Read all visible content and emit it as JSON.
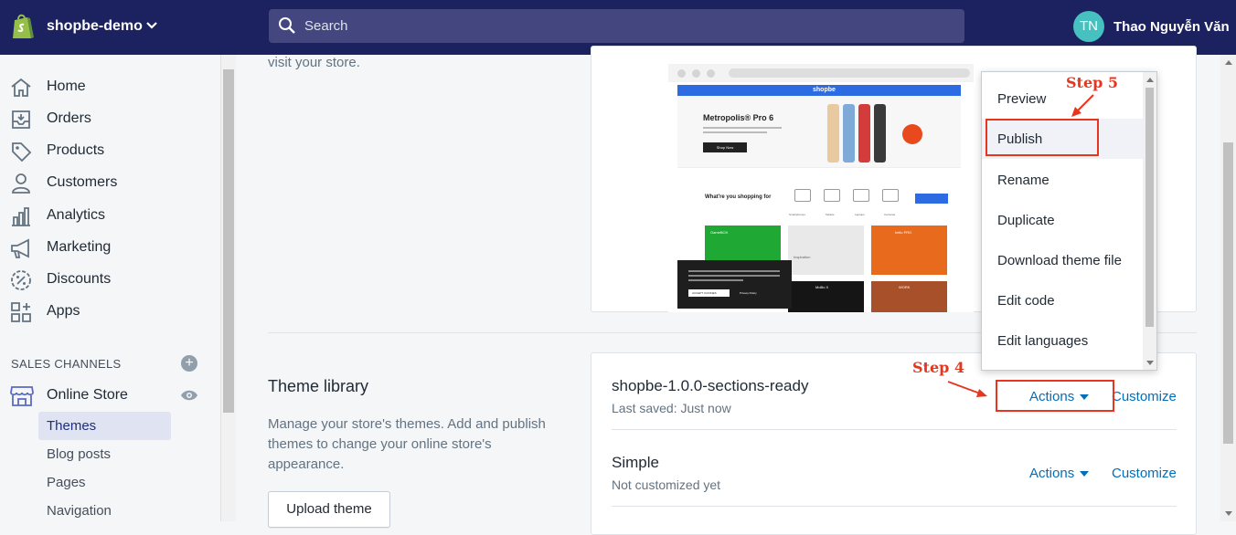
{
  "topbar": {
    "store_name": "shopbe-demo",
    "search_placeholder": "Search",
    "avatar_initials": "TN",
    "user_name": "Thao Nguyễn Văn",
    "bg_color": "#1c2260"
  },
  "sidebar": {
    "items": [
      {
        "label": "Home",
        "icon": "home-icon"
      },
      {
        "label": "Orders",
        "icon": "orders-icon"
      },
      {
        "label": "Products",
        "icon": "tag-icon"
      },
      {
        "label": "Customers",
        "icon": "person-icon"
      },
      {
        "label": "Analytics",
        "icon": "bar-chart-icon"
      },
      {
        "label": "Marketing",
        "icon": "megaphone-icon"
      },
      {
        "label": "Discounts",
        "icon": "discount-icon"
      },
      {
        "label": "Apps",
        "icon": "apps-icon"
      }
    ],
    "section_title": "SALES CHANNELS",
    "channel": "Online Store",
    "sub_items": [
      "Themes",
      "Blog posts",
      "Pages",
      "Navigation"
    ],
    "active_sub_item": "Themes"
  },
  "main": {
    "visit_text": "visit your store.",
    "theme_library": {
      "title": "Theme library",
      "description": "Manage your store's themes. Add and publish themes to change your online store's appearance.",
      "upload_button": "Upload theme"
    },
    "themes": [
      {
        "name": "shopbe-1.0.0-sections-ready",
        "status": "Last saved: Just now",
        "actions": "Actions",
        "customize": "Customize"
      },
      {
        "name": "Simple",
        "status": "Not customized yet",
        "actions": "Actions",
        "customize": "Customize"
      }
    ]
  },
  "actions_menu": {
    "items": [
      "Preview",
      "Publish",
      "Rename",
      "Duplicate",
      "Download theme file",
      "Edit code",
      "Edit languages"
    ],
    "highlighted": "Publish"
  },
  "preview": {
    "brand": "shopbe",
    "hero_title": "Metropolis® Pro 6",
    "hero_button": "Shop Now",
    "section_heading": "What're you shopping for",
    "categories": [
      "Smartphones",
      "Tablets",
      "Laptops",
      "Cameras"
    ],
    "tiles": [
      "GameBOX",
      "Inspiration",
      "hello PRO",
      "MoBo X",
      "WORK"
    ],
    "cookie_button": "ACCEPT COOKIES",
    "cookie_link": "Privacy Policy"
  },
  "annotations": {
    "step4": "Step 4",
    "step5": "Step 5",
    "color": "#e8361e"
  }
}
